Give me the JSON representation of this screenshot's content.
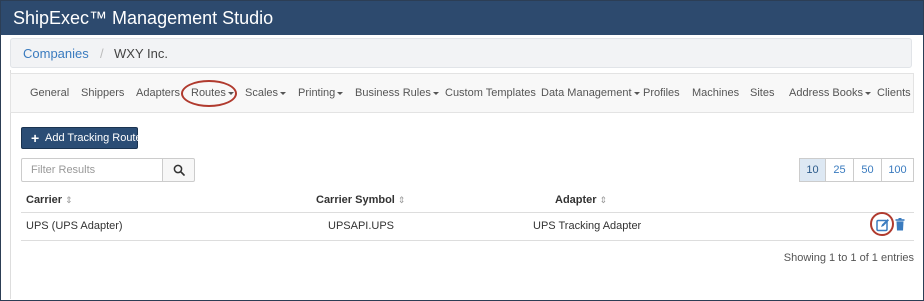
{
  "app": {
    "title": "ShipExec™ Management Studio"
  },
  "breadcrumb": {
    "parent": "Companies",
    "separator": "/",
    "current": "WXY Inc."
  },
  "nav": {
    "items": [
      {
        "label": "General"
      },
      {
        "label": "Shippers"
      },
      {
        "label": "Adapters"
      },
      {
        "label": "Routes",
        "dropdown": true,
        "highlighted": true
      },
      {
        "label": "Scales",
        "dropdown": true
      },
      {
        "label": "Printing",
        "dropdown": true
      },
      {
        "label": "Business Rules",
        "dropdown": true
      },
      {
        "label": "Custom Templates"
      },
      {
        "label": "Data Management",
        "dropdown": true
      },
      {
        "label": "Profiles"
      },
      {
        "label": "Machines"
      },
      {
        "label": "Sites"
      },
      {
        "label": "Address Books",
        "dropdown": true
      },
      {
        "label": "Clients"
      }
    ]
  },
  "toolbar": {
    "add_label": "Add Tracking Route"
  },
  "filter": {
    "placeholder": "Filter Results",
    "value": ""
  },
  "page_size": {
    "options": [
      "10",
      "25",
      "50",
      "100"
    ],
    "selected": "10"
  },
  "table": {
    "columns": [
      "Carrier",
      "Carrier Symbol",
      "Adapter"
    ],
    "sort_glyph": "⇕",
    "rows": [
      {
        "carrier": "UPS (UPS Adapter)",
        "symbol": "UPSAPI.UPS",
        "adapter": "UPS Tracking Adapter"
      }
    ]
  },
  "footer": {
    "info": "Showing 1 to 1 of 1 entries"
  },
  "colors": {
    "titlebar": "#2d4a6e",
    "link": "#3a7bbf",
    "primary_button": "#2b4d75",
    "highlight_ring": "#b03a2e"
  }
}
